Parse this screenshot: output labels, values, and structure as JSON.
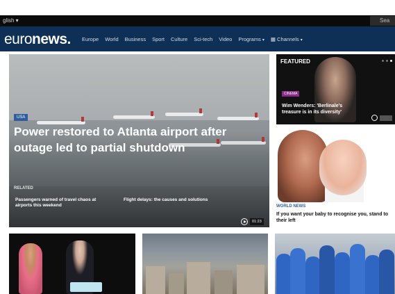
{
  "topbar": {
    "language": "glish ▾",
    "search_label": "Sea"
  },
  "navbar": {
    "logo_light": "euro",
    "logo_bold": "news.",
    "items": [
      "Europe",
      "World",
      "Business",
      "Sport",
      "Culture",
      "Sci-tech",
      "Video"
    ],
    "programs": "Programs",
    "channels": "Channels"
  },
  "hero": {
    "tag": "USA",
    "headline": "Power restored to Atlanta airport after outage led to partial shutdown",
    "related_label": "RELATED",
    "related": [
      "Passengers warned of travel chaos at airports this weekend",
      "Flight delays: the causes and solutions"
    ],
    "duration": "01:23"
  },
  "featured": {
    "label": "FEATURED",
    "tag": "CINEMA",
    "title": "Wim Wenders: 'Berlinale's treasure is in its diversity'"
  },
  "side_story": {
    "tag": "WORLD NEWS",
    "title": "If you want your baby to recognise you, stand to their left"
  },
  "icons": {
    "play": "play-icon",
    "channels": "grid-icon",
    "dropdown": "chevron-down-icon"
  },
  "colors": {
    "navbar": "#0e2f56",
    "accent": "#2f5d9b",
    "cinema": "#8a2b8c"
  }
}
